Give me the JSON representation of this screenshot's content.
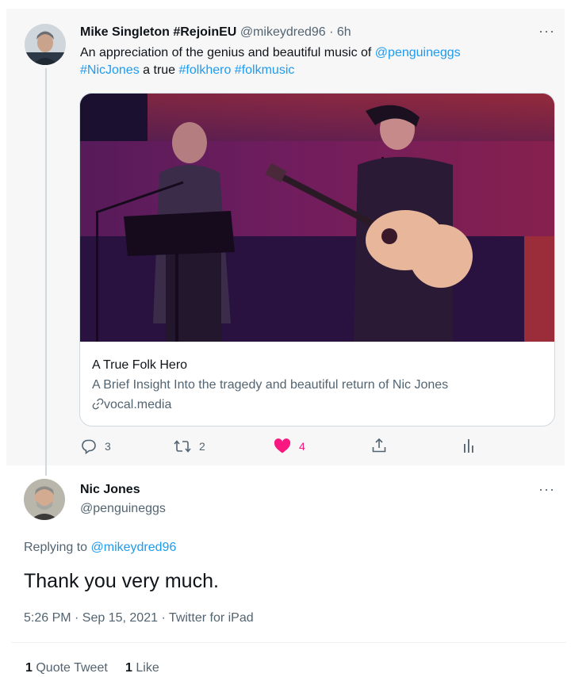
{
  "parent_tweet": {
    "display_name": "Mike Singleton #RejoinEU",
    "handle": "@mikeydred96",
    "separator": "·",
    "time_ago": "6h",
    "text_part1": "An appreciation of the genius and beautiful music of ",
    "mention": "@penguineggs",
    "hashtag1": "#NicJones",
    "text_part2": " a true ",
    "hashtag2": "#folkhero",
    "hashtag3": "#folkmusic",
    "more_label": "···",
    "card": {
      "title": "A True Folk Hero",
      "description": "A Brief Insight Into the tragedy and beautiful return of Nic Jones",
      "domain": "vocal.media"
    },
    "actions": {
      "reply_count": "3",
      "retweet_count": "2",
      "like_count": "4"
    }
  },
  "reply_tweet": {
    "display_name": "Nic Jones",
    "handle": "@penguineggs",
    "more_label": "···",
    "replying_prefix": "Replying to ",
    "replying_to": "@mikeydred96",
    "text": "Thank you very much.",
    "timestamp": "5:26 PM · Sep 15, 2021 · Twitter for iPad",
    "quote_count": "1",
    "quote_label": "Quote Tweet",
    "like_count": "1",
    "like_label": "Like"
  },
  "colors": {
    "accent_blue": "#1d9bf0",
    "like_pink": "#f91880",
    "muted_gray": "#536471"
  },
  "icons": [
    "reply-icon",
    "retweet-icon",
    "heart-icon",
    "share-icon",
    "analytics-icon",
    "link-icon",
    "more-icon"
  ]
}
